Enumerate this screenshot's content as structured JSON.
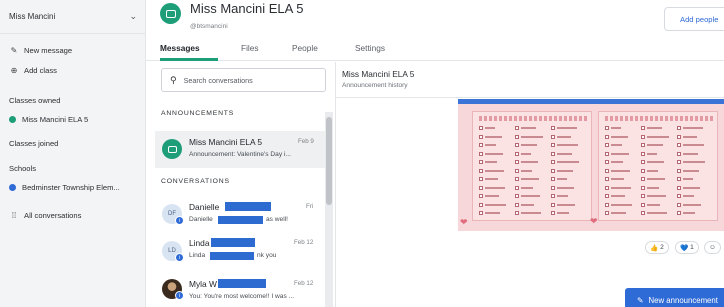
{
  "sidebar": {
    "account_name": "Miss Mancini",
    "new_message": "New message",
    "add_class": "Add class",
    "classes_owned_heading": "Classes owned",
    "classes_owned": [
      {
        "label": "Miss Mancini ELA 5",
        "color": "#1e9d79"
      }
    ],
    "classes_joined_heading": "Classes joined",
    "schools_heading": "Schools",
    "schools": [
      {
        "label": "Bedminster Township Elem...",
        "color": "#2f6bd6"
      }
    ],
    "all_conversations": "All conversations"
  },
  "header": {
    "class_title": "Miss Mancini ELA 5",
    "class_handle": "@btsmancini",
    "add_people": "Add people",
    "accent_color": "#1e9d79"
  },
  "tabs": [
    {
      "label": "Messages",
      "active": true
    },
    {
      "label": "Files",
      "active": false
    },
    {
      "label": "People",
      "active": false
    },
    {
      "label": "Settings",
      "active": false
    }
  ],
  "conversations": {
    "search_placeholder": "Search conversations",
    "announcements_heading": "ANNOUNCEMENTS",
    "conversations_heading": "CONVERSATIONS",
    "announcement": {
      "name": "Miss Mancini ELA 5",
      "date": "Feb 9",
      "preview": "Announcement: Valentine's Day i..."
    },
    "items": [
      {
        "name": "Danielle",
        "initials": "DF",
        "date": "Fri",
        "preview_start": "Danielle",
        "preview_end": "as well!"
      },
      {
        "name": "Linda",
        "initials": "LD",
        "date": "Feb 12",
        "preview_start": "Linda",
        "preview_end": "nk you"
      },
      {
        "name": "Myla W",
        "initials": "",
        "date": "Feb 12",
        "preview": "You: You're most welcome!! I was ..."
      }
    ]
  },
  "detail": {
    "title": "Miss Mancini ELA 5",
    "subtitle": "Announcement history",
    "reactions": [
      {
        "icon": "thumbs-up-icon",
        "glyph": "👍",
        "count": "2"
      },
      {
        "icon": "heart-icon",
        "glyph": "💙",
        "count": "1"
      },
      {
        "icon": "add-reaction-icon",
        "glyph": "☺",
        "count": "+"
      }
    ],
    "new_announcement": "New announcement"
  }
}
